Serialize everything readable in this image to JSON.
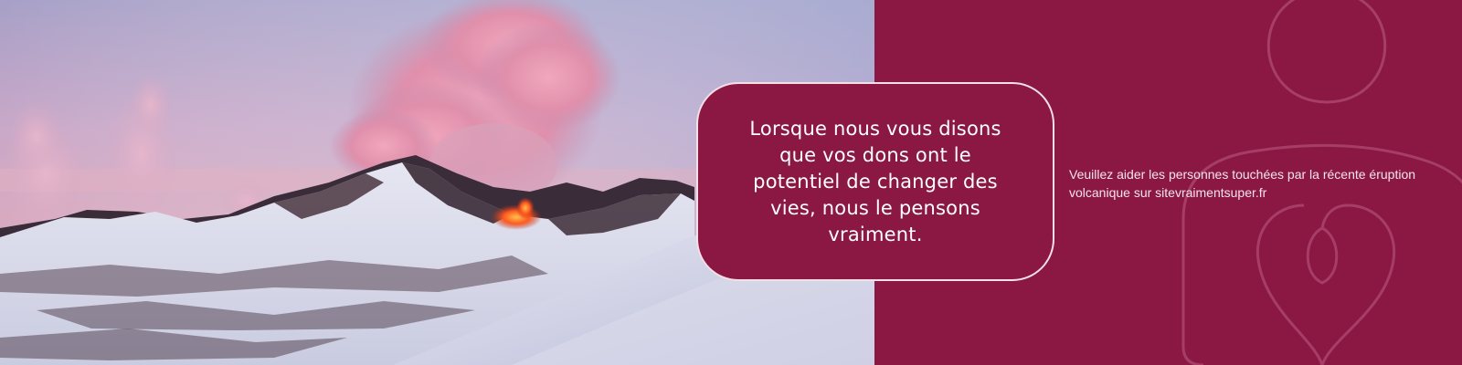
{
  "banner": {
    "quote": "Lorsque nous vous disons que vos dons ont le potentiel de changer des vies, nous le pensons vraiment.",
    "help_text": "Veuillez aider les personnes touchées par la récente éruption volcanique sur sitevraimentsuper.fr"
  },
  "colors": {
    "brand": "#8a1843",
    "card_border": "#f4dfe6",
    "text": "#ffffff"
  },
  "icons": [
    "heart-outline-icon"
  ]
}
